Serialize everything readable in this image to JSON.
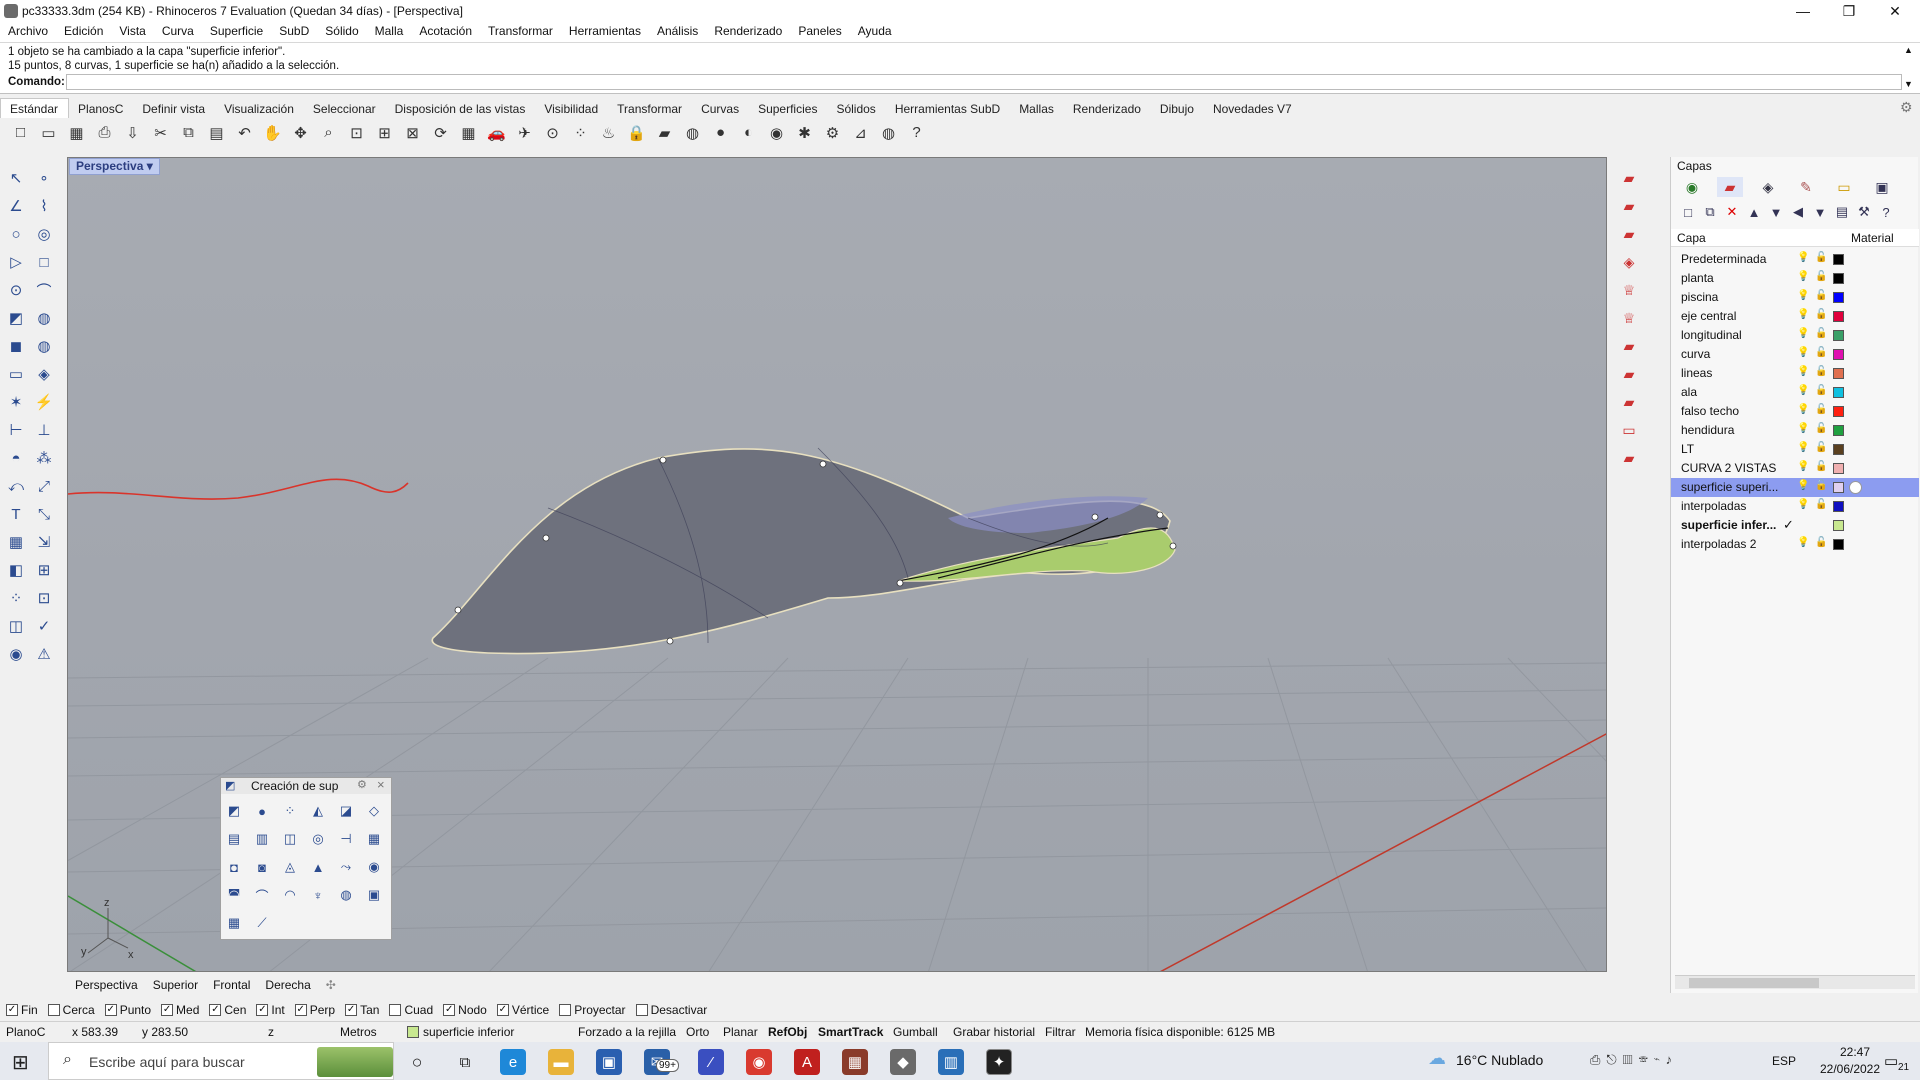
{
  "window": {
    "title": "pc33333.3dm (254 KB) - Rhinoceros 7 Evaluation (Quedan 34 días) - [Perspectiva]",
    "minimize": "—",
    "maximize": "❐",
    "close": "✕"
  },
  "menu": [
    "Archivo",
    "Edición",
    "Vista",
    "Curva",
    "Superficie",
    "SubD",
    "Sólido",
    "Malla",
    "Acotación",
    "Transformar",
    "Herramientas",
    "Análisis",
    "Renderizado",
    "Paneles",
    "Ayuda"
  ],
  "command": {
    "history_line1": "1 objeto se ha cambiado a la capa \"superficie inferior\".",
    "history_line2": "15 puntos, 8 curvas, 1 superficie se ha(n) añadido a la selección.",
    "prompt_label": "Comando:",
    "prompt_value": ""
  },
  "toolbar_tabs": [
    "Estándar",
    "PlanosC",
    "Definir vista",
    "Visualización",
    "Seleccionar",
    "Disposición de las vistas",
    "Visibilidad",
    "Transformar",
    "Curvas",
    "Superficies",
    "Sólidos",
    "Herramientas SubD",
    "Mallas",
    "Renderizado",
    "Dibujo",
    "Novedades V7"
  ],
  "toolbar_icons": [
    "new-icon",
    "open-icon",
    "save-icon",
    "print-icon",
    "import-icon",
    "cut-icon",
    "copy-icon",
    "paste-icon",
    "undo-icon",
    "pan-icon",
    "move-view-icon",
    "zoom-icon",
    "zoom-window-icon",
    "zoom-extents-icon",
    "zoom-selected-icon",
    "rotate-view-icon",
    "four-views-icon",
    "car-icon",
    "plane-icon",
    "snap-icon",
    "points-icon",
    "light-icon",
    "lock-icon",
    "layer-icon",
    "color-wheel-icon",
    "shaded-sphere-icon",
    "render-sphere-icon",
    "material-sphere-icon",
    "options-icon",
    "settings-icon",
    "tree-icon",
    "globe-icon",
    "help-icon"
  ],
  "viewport": {
    "name": "Perspectiva",
    "axis_x": "x",
    "axis_y": "y",
    "axis_z": "z"
  },
  "viewport_tabs": [
    "Perspectiva",
    "Superior",
    "Frontal",
    "Derecha"
  ],
  "floating_toolbar": {
    "title": "Creación de sup",
    "gear": "⚙",
    "close": "×"
  },
  "layers_panel": {
    "title": "Capas",
    "col_layer": "Capa",
    "col_material": "Material",
    "layers": [
      {
        "name": "Predeterminada",
        "color": "#000000"
      },
      {
        "name": "planta",
        "color": "#000000"
      },
      {
        "name": "piscina",
        "color": "#0000ff"
      },
      {
        "name": "eje central",
        "color": "#e0003c"
      },
      {
        "name": "longitudinal",
        "color": "#3aa068"
      },
      {
        "name": "curva",
        "color": "#e010b0"
      },
      {
        "name": "lineas",
        "color": "#e07050"
      },
      {
        "name": "ala",
        "color": "#10c0e0"
      },
      {
        "name": "falso techo",
        "color": "#ff2010"
      },
      {
        "name": "hendidura",
        "color": "#20a040"
      },
      {
        "name": "LT",
        "color": "#5a4020"
      },
      {
        "name": "CURVA 2 VISTAS",
        "color": "#f0b0b0"
      },
      {
        "name": "superficie superi...",
        "color": "#e0d0f0",
        "selected": true
      },
      {
        "name": "interpoladas",
        "color": "#1010c0"
      },
      {
        "name": "superficie infer...",
        "color": "#c8e890",
        "current": true
      },
      {
        "name": "interpoladas 2",
        "color": "#000000"
      }
    ]
  },
  "osnaps": [
    {
      "label": "Fin",
      "checked": true
    },
    {
      "label": "Cerca",
      "checked": false
    },
    {
      "label": "Punto",
      "checked": true
    },
    {
      "label": "Med",
      "checked": true
    },
    {
      "label": "Cen",
      "checked": true
    },
    {
      "label": "Int",
      "checked": true
    },
    {
      "label": "Perp",
      "checked": true
    },
    {
      "label": "Tan",
      "checked": true
    },
    {
      "label": "Cuad",
      "checked": false
    },
    {
      "label": "Nodo",
      "checked": true
    },
    {
      "label": "Vértice",
      "checked": true
    },
    {
      "label": "Proyectar",
      "checked": false
    },
    {
      "label": "Desactivar",
      "checked": false
    }
  ],
  "status": {
    "cplane": "PlanoC",
    "x": "x 583.39",
    "y": "y 283.50",
    "z": "z",
    "units": "Metros",
    "layer": "superficie inferior",
    "grid_snap": "Forzado a la rejilla",
    "ortho": "Orto",
    "planar": "Planar",
    "refobj": "RefObj",
    "smarttrack": "SmartTrack",
    "gumball": "Gumball",
    "history": "Grabar historial",
    "filter": "Filtrar",
    "memory": "Memoria física disponible: 6125 MB"
  },
  "taskbar": {
    "search_placeholder": "Escribe aquí para buscar",
    "weather": "16°C  Nublado",
    "lang": "ESP",
    "time": "22:47",
    "date": "22/06/2022",
    "mail_badge": "99+",
    "notif_count": "21"
  }
}
